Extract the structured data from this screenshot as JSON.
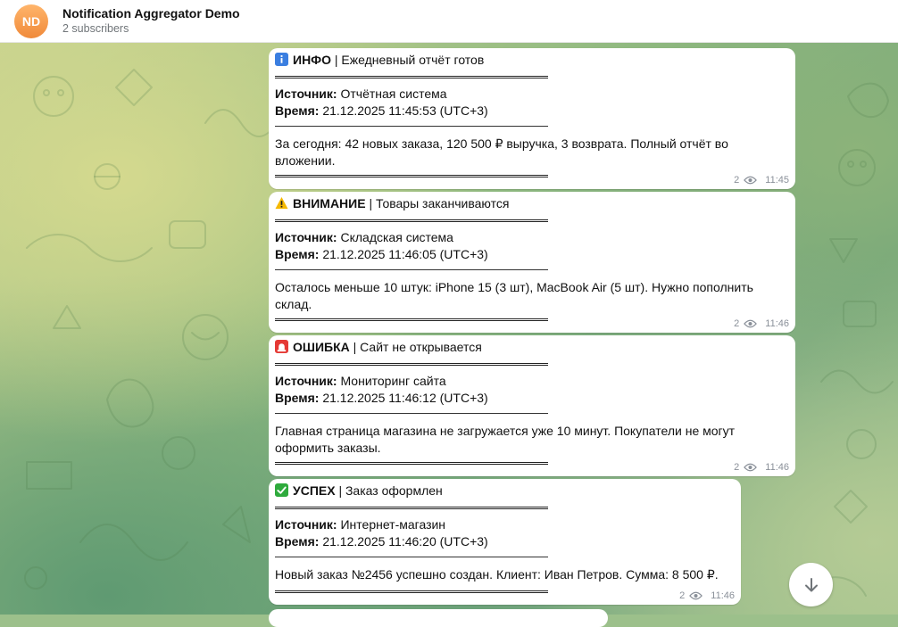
{
  "channel": {
    "avatar_initials": "ND",
    "title": "Notification Aggregator Demo",
    "subtitle": "2 subscribers"
  },
  "colors": {
    "avatar": "#f08a3a",
    "bubble": "#ffffff",
    "meta_text": "#8a9099",
    "info_emoji": "#3a7ee0",
    "error_emoji": "#e53935",
    "success_emoji": "#2eaa3c"
  },
  "messages": [
    {
      "icon": "info-icon",
      "type_label": "ИНФО",
      "headline": " | Ежедневный отчёт готов",
      "separator": "══════════════════════════════",
      "source_label": "Источник:",
      "source_value": " Отчётная система",
      "time_label": "Время:",
      "time_value": " 21.12.2025 11:45:53 (UTC+3)",
      "thin_separator": "──────────────────────────────",
      "body_line1": "За сегодня: 42 новых заказа, 120 500 ₽ выручка, 3 возврата. Полный отчёт во",
      "body_line2": "вложении.",
      "views": "2",
      "time": "11:45"
    },
    {
      "icon": "warning-icon",
      "type_label": "ВНИМАНИЕ",
      "headline": " | Товары заканчиваются",
      "separator": "══════════════════════════════",
      "source_label": "Источник:",
      "source_value": " Складская система",
      "time_label": "Время:",
      "time_value": " 21.12.2025 11:46:05 (UTC+3)",
      "thin_separator": "──────────────────────────────",
      "body_line1": "Осталось меньше 10 штук: iPhone 15 (3 шт), MacBook Air (5 шт). Нужно пополнить",
      "body_line2": "склад.",
      "views": "2",
      "time": "11:46"
    },
    {
      "icon": "siren-icon",
      "type_label": "ОШИБКА",
      "headline": " | Сайт не открывается",
      "separator": "══════════════════════════════",
      "source_label": "Источник:",
      "source_value": " Мониторинг сайта",
      "time_label": "Время:",
      "time_value": " 21.12.2025 11:46:12 (UTC+3)",
      "thin_separator": "──────────────────────────────",
      "body_line1": "Главная страница магазина не загружается уже 10 минут. Покупатели не могут",
      "body_line2": "оформить заказы.",
      "views": "2",
      "time": "11:46"
    },
    {
      "icon": "check-icon",
      "type_label": "УСПЕХ",
      "headline": " | Заказ оформлен",
      "separator": "══════════════════════════════",
      "source_label": "Источник:",
      "source_value": " Интернет-магазин",
      "time_label": "Время:",
      "time_value": " 21.12.2025 11:46:20 (UTC+3)",
      "thin_separator": "──────────────────────────────",
      "body_line1": "Новый заказ №2456 успешно создан. Клиент: Иван Петров. Сумма: 8 500 ₽.",
      "views": "2",
      "time": "11:46"
    }
  ],
  "scroll_button_icon": "arrow-down-icon"
}
